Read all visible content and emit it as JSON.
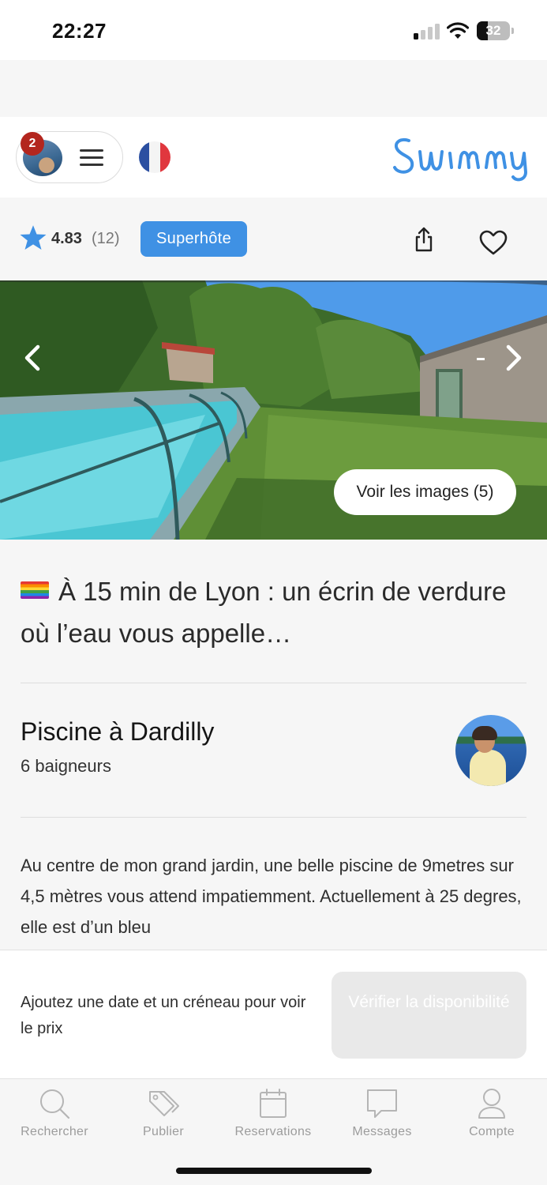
{
  "status_bar": {
    "time": "22:27",
    "battery": "32"
  },
  "header": {
    "notification_count": "2",
    "flag": "france-flag",
    "logo_text": "Swimmy",
    "brand_color": "#3f91e4"
  },
  "rating": {
    "value": "4.83",
    "count": "(12)",
    "badge": "Superhôte"
  },
  "hero": {
    "see_images_label": "Voir les images (5)"
  },
  "title": "À 15 min de Lyon : un écrin de verdure où l’eau vous appelle…",
  "listing": {
    "name": "Piscine à Dardilly",
    "capacity": "6 baigneurs"
  },
  "description": "Au centre de mon grand jardin, une belle piscine de 9metres sur 4,5 mètres vous attend impatiemment. Actuellement à 25 degres, elle est d’un bleu",
  "booking": {
    "prompt": "Ajoutez une date et un créneau pour voir le prix",
    "button_label": "Vérifier la disponibilité"
  },
  "tabs": [
    {
      "label": "Rechercher",
      "icon": "search-icon"
    },
    {
      "label": "Publier",
      "icon": "tag-icon"
    },
    {
      "label": "Reservations",
      "icon": "calendar-icon"
    },
    {
      "label": "Messages",
      "icon": "message-icon"
    },
    {
      "label": "Compte",
      "icon": "account-icon"
    }
  ]
}
